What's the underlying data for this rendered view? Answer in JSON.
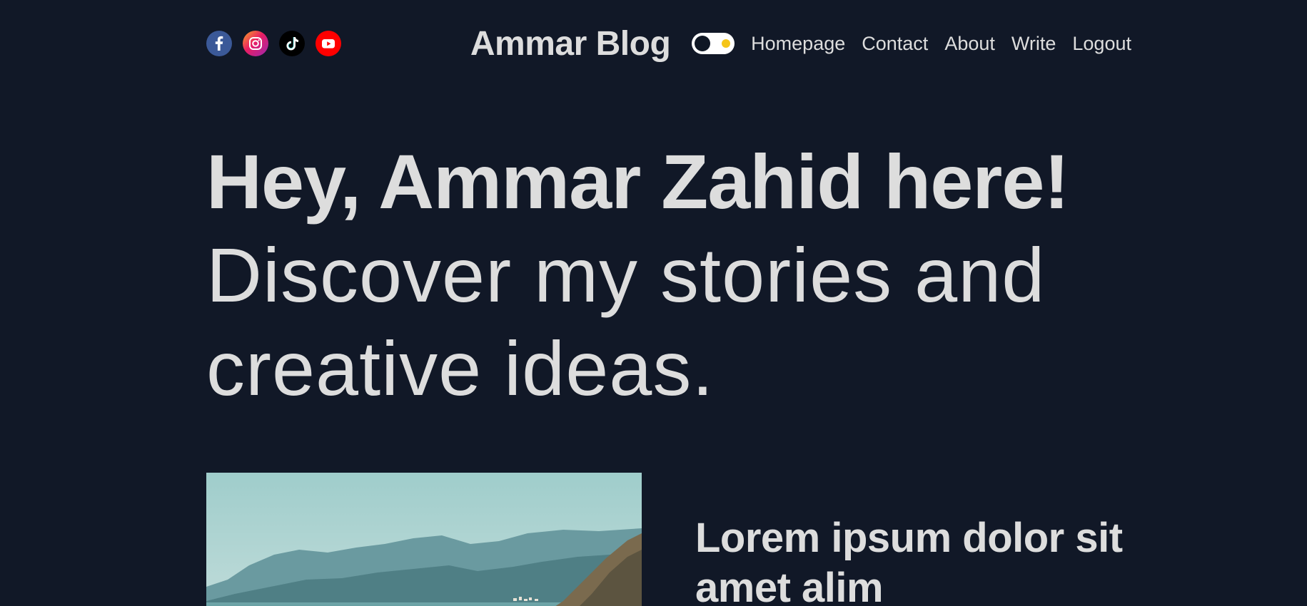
{
  "header": {
    "logo": "Ammar Blog",
    "social_icons": [
      "facebook-icon",
      "instagram-icon",
      "tiktok-icon",
      "youtube-icon"
    ],
    "nav": [
      "Homepage",
      "Contact",
      "About",
      "Write",
      "Logout"
    ]
  },
  "hero": {
    "greeting": "Hey, Ammar Zahid here!",
    "tagline": "Discover my stories and creative ideas."
  },
  "featured": {
    "title": "Lorem ipsum dolor sit amet alim"
  },
  "colors": {
    "background": "#111827",
    "text": "#dddddd",
    "toggle_accent": "#f5c518",
    "facebook": "#3b5998",
    "youtube": "#ff0000"
  }
}
